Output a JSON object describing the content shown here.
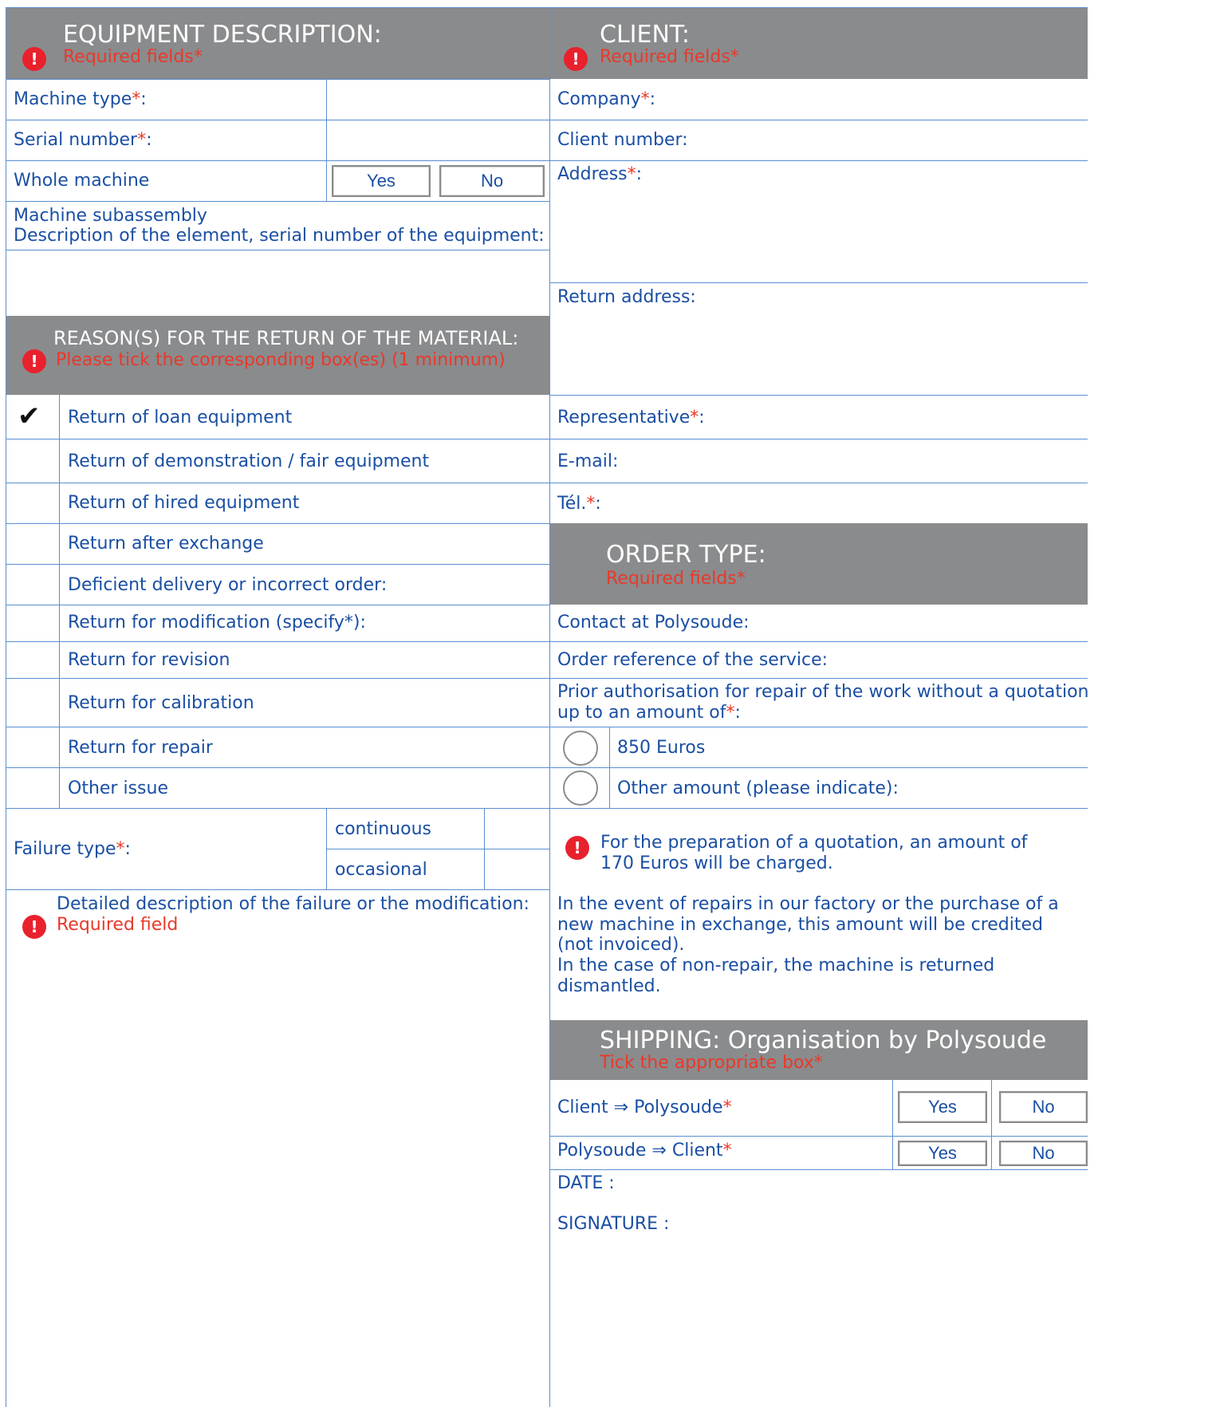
{
  "equipment": {
    "title": "EQUIPMENT DESCRIPTION:",
    "required": "Required fields*",
    "machine_type": "Machine type",
    "serial_number": "Serial number",
    "whole_machine": "Whole machine",
    "yes": "Yes",
    "no": "No",
    "subassembly_line1": "Machine subassembly",
    "subassembly_line2": "Description of the element, serial number of the equipment:"
  },
  "reasons": {
    "title": "REASON(S) FOR THE RETURN OF THE MATERIAL:",
    "instruction": "Please tick the corresponding box(es) (1 minimum)",
    "items": [
      {
        "label": "Return of loan equipment",
        "checked": true
      },
      {
        "label": "Return of demonstration / fair equipment",
        "checked": false
      },
      {
        "label": "Return of hired equipment",
        "checked": false
      },
      {
        "label": "Return after exchange",
        "checked": false
      },
      {
        "label": "Deficient delivery or incorrect order:",
        "checked": false
      },
      {
        "label": "Return for modification (specify*):",
        "checked": false
      },
      {
        "label": "Return for revision",
        "checked": false
      },
      {
        "label": "Return for calibration",
        "checked": false
      },
      {
        "label": "Return for repair",
        "checked": false
      },
      {
        "label": "Other issue",
        "checked": false
      }
    ],
    "check_mark": "✔"
  },
  "failure": {
    "label": "Failure type",
    "continuous": "continuous",
    "occasional": "occasional",
    "detail_label": "Detailed description of the failure or the modification:",
    "detail_required": "Required field"
  },
  "client": {
    "title": "CLIENT:",
    "required": "Required fields*",
    "company": "Company",
    "client_number": "Client number:",
    "address": "Address",
    "return_address": "Return address:",
    "representative": "Representative",
    "email": "E-mail:",
    "tel": "Tél."
  },
  "order": {
    "title": "ORDER TYPE:",
    "required": "Required fields*",
    "contact": "Contact at Polysoude:",
    "order_reference": "Order reference of the service:",
    "prior_line1": "Prior authorisation for repair of the work without a quotation",
    "prior_line2": "up to an amount of",
    "option_850": "850 Euros",
    "option_other": "Other amount (please indicate):",
    "quote_line1": "For the preparation of a quotation, an amount of",
    "quote_line2": "170 Euros will be charged.",
    "note_lines": [
      "In the event of repairs in our factory or the purchase of a",
      "new machine in exchange, this amount will be credited",
      "(not invoiced).",
      "In the case of non-repair, the machine is returned",
      "dismantled."
    ]
  },
  "shipping": {
    "title": "SHIPPING: Organisation by Polysoude",
    "required": "Tick the appropriate box*",
    "client_to_poly": "Client ⇒ Polysoude",
    "poly_to_client": "Polysoude ⇒ Client",
    "yes": "Yes",
    "no": "No",
    "date": "DATE :",
    "signature": "SIGNATURE :"
  },
  "common": {
    "asterisk": "*",
    "colon": ":",
    "warn_glyph": "!"
  },
  "colors": {
    "header_bg": "#8a8b8d",
    "text": "#1a4fa3",
    "required": "#e8392a",
    "rule": "#5a8fd0"
  }
}
